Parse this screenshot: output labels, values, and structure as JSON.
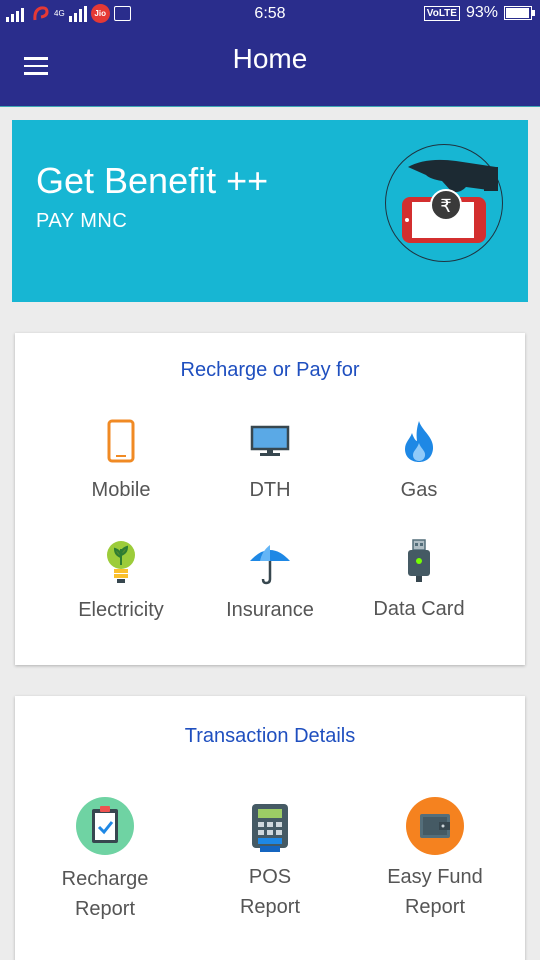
{
  "status_bar": {
    "network_label": "4G",
    "jio_label": "Jio",
    "time": "6:58",
    "volte": "VoLTE",
    "battery": "93%"
  },
  "app_bar": {
    "title": "Home"
  },
  "banner": {
    "title": "Get Benefit ++",
    "subtitle": "PAY MNC",
    "logo_symbol": "₹"
  },
  "recharge": {
    "title": "Recharge or Pay for",
    "items": [
      {
        "label": "Mobile",
        "icon": "mobile-phone-icon"
      },
      {
        "label": "DTH",
        "icon": "monitor-icon"
      },
      {
        "label": "Gas",
        "icon": "flame-icon"
      },
      {
        "label": "Electricity",
        "icon": "lightbulb-icon"
      },
      {
        "label": "Insurance",
        "icon": "umbrella-icon"
      },
      {
        "label": "Data Card",
        "icon": "usb-dongle-icon"
      }
    ]
  },
  "transactions": {
    "title": "Transaction Details",
    "items": [
      {
        "line1": "Recharge",
        "line2": "Report",
        "icon": "clipboard-check-icon"
      },
      {
        "line1": "POS",
        "line2": "Report",
        "icon": "pos-terminal-icon"
      },
      {
        "line1": "Easy Fund",
        "line2": "Report",
        "icon": "wallet-icon"
      }
    ]
  },
  "colors": {
    "primary": "#2a2d8c",
    "banner": "#17b6d3",
    "card_title": "#1f4fbf",
    "background": "#ececec"
  }
}
